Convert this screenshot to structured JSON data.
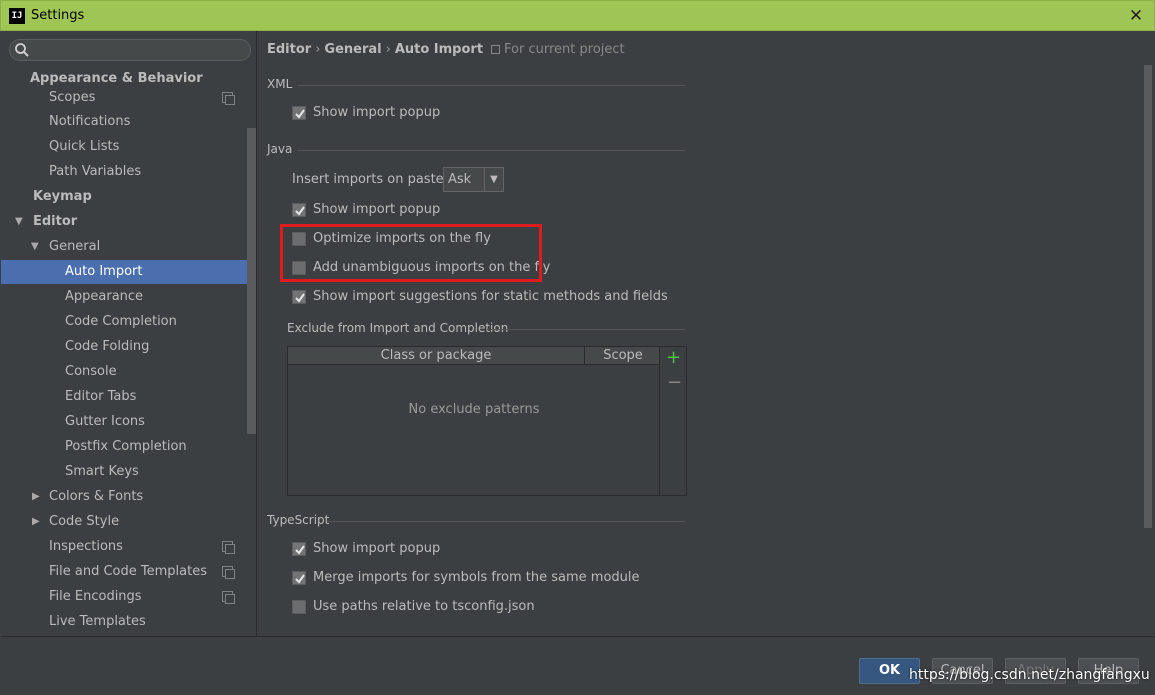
{
  "window": {
    "title": "Settings",
    "app_icon": "IJ"
  },
  "search": {
    "placeholder": ""
  },
  "sidebar": {
    "items": [
      {
        "label": "Appearance & Behavior"
      },
      {
        "label": "Scopes"
      },
      {
        "label": "Notifications"
      },
      {
        "label": "Quick Lists"
      },
      {
        "label": "Path Variables"
      },
      {
        "label": "Keymap"
      },
      {
        "label": "Editor"
      },
      {
        "label": "General"
      },
      {
        "label": "Auto Import"
      },
      {
        "label": "Appearance"
      },
      {
        "label": "Code Completion"
      },
      {
        "label": "Code Folding"
      },
      {
        "label": "Console"
      },
      {
        "label": "Editor Tabs"
      },
      {
        "label": "Gutter Icons"
      },
      {
        "label": "Postfix Completion"
      },
      {
        "label": "Smart Keys"
      },
      {
        "label": "Colors & Fonts"
      },
      {
        "label": "Code Style"
      },
      {
        "label": "Inspections"
      },
      {
        "label": "File and Code Templates"
      },
      {
        "label": "File Encodings"
      },
      {
        "label": "Live Templates"
      }
    ]
  },
  "breadcrumb": {
    "editor": "Editor",
    "general": "General",
    "current": "Auto Import",
    "sep": "›",
    "scope": "For current project"
  },
  "xml": {
    "title": "XML",
    "show_popup": "Show import popup"
  },
  "java": {
    "title": "Java",
    "insert_label": "Insert imports on paste:",
    "insert_value": "Ask",
    "show_popup": "Show import popup",
    "optimize": "Optimize imports on the fly",
    "add_unambiguous": "Add unambiguous imports on the fly",
    "static_suggestions": "Show import suggestions for static methods and fields"
  },
  "exclude": {
    "title": "Exclude from Import and Completion",
    "col_class": "Class or package",
    "col_scope": "Scope",
    "empty": "No exclude patterns",
    "add": "+",
    "remove": "−"
  },
  "typescript": {
    "title": "TypeScript",
    "show_popup": "Show import popup",
    "merge": "Merge imports for symbols from the same module",
    "paths_relative": "Use paths relative to tsconfig.json"
  },
  "footer": {
    "ok": "OK",
    "cancel": "Cancel",
    "apply": "Apply",
    "help": "Help"
  },
  "watermark": "https://blog.csdn.net/zhangfangxu",
  "colors": {
    "accent_titlebar": "#9fc654",
    "selection": "#4b6eaf",
    "highlight": "#e01b1b",
    "add_icon": "#4ec245"
  }
}
